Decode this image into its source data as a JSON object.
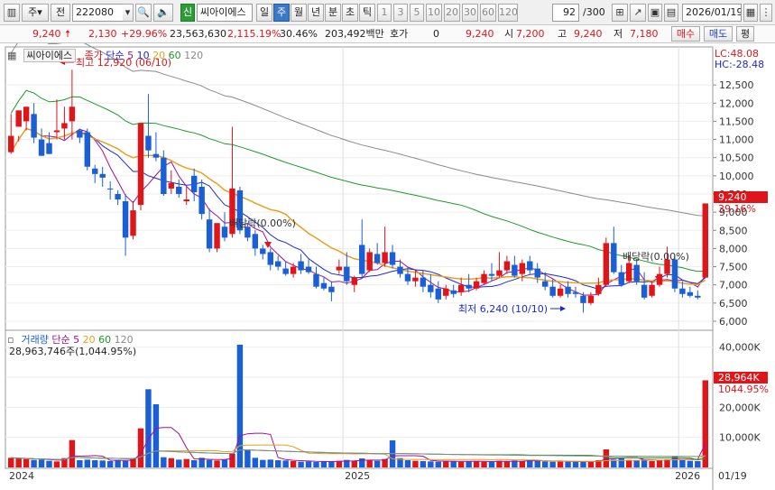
{
  "toolbar": {
    "market": "주",
    "prefix": "전",
    "code": "222080",
    "badge": "신",
    "name": "씨아이에스",
    "periods": [
      {
        "label": "일",
        "selected": false
      },
      {
        "label": "주",
        "selected": true
      },
      {
        "label": "월",
        "selected": false
      },
      {
        "label": "년",
        "selected": false
      },
      {
        "label": "분",
        "selected": false
      },
      {
        "label": "초",
        "selected": false
      },
      {
        "label": "틱",
        "selected": false
      }
    ],
    "intervals": [
      "1",
      "3",
      "5",
      "10",
      "20",
      "30",
      "60",
      "120"
    ],
    "count": "92",
    "count_total": "/300",
    "date": "2026/01/19"
  },
  "quote": {
    "price": "9,240",
    "change": "2,130",
    "change_pct": "+29.96%",
    "volume": "23,563,630",
    "volume_pct": "2,115.19%",
    "turnover_pct": "30.46%",
    "amount": "203,492백만",
    "hoga_label": "호가",
    "hoga_value": "0",
    "ask": "9,240",
    "open_label": "시",
    "open": "7,200",
    "high_label": "고",
    "high": "9,240",
    "low_label": "저",
    "low": "7,180",
    "buy_label": "매수",
    "sell_label": "매도",
    "eval_label": "평"
  },
  "price_panel": {
    "stock_tag": "씨아이에스",
    "legend_close": "종가",
    "legend_ma_type": "단순",
    "legend_mas": [
      "5",
      "10",
      "20",
      "60",
      "120"
    ],
    "lc_label": "LC:48.08",
    "hc_label": "HC:-28.48",
    "high_note": "최고 12,920 (06/10)",
    "low_note": "최저 6,240 (10/10)",
    "div_note_1": "배당락(0.00%)",
    "div_note_2": "배당락(0.00%)",
    "current_price_tag": "9,240",
    "current_pct_tag": "39.16%",
    "y_ticks": [
      "12,500",
      "12,000",
      "11,500",
      "11,000",
      "10,500",
      "10,000",
      "9,500",
      "9,000",
      "8,500",
      "8,000",
      "7,500",
      "7,000",
      "6,500",
      "6,000"
    ]
  },
  "volume_panel": {
    "legend_label": "거래량",
    "legend_ma_type": "단순",
    "legend_mas": [
      "5",
      "20",
      "60",
      "120"
    ],
    "current_text": "28,963,746주(1,044.95%)",
    "current_tag": "28,964K",
    "current_pct_tag": "1044.95%",
    "y_ticks": [
      "40,000K",
      "30,000K",
      "20,000K",
      "10,000K"
    ]
  },
  "x_axis": {
    "labels": [
      "2024",
      "2025",
      "2026"
    ],
    "cursor_date": "01/19"
  },
  "colors": {
    "up": "#e0151a",
    "down": "#1a5fd6",
    "ma5": "#a0109a",
    "ma10": "#1a2ad0",
    "ma20": "#e8a020",
    "ma60": "#1d9a2a",
    "ma120": "#8a8a8a"
  },
  "chart_data": {
    "type": "candlestick",
    "interval": "weekly",
    "y_range": [
      5950,
      12900
    ],
    "candles": [
      [
        11100,
        11700,
        10650,
        10600,
        "u"
      ],
      [
        11800,
        11100,
        11350,
        10950,
        "u"
      ],
      [
        11500,
        11900,
        11900,
        11250,
        "u"
      ],
      [
        11700,
        12000,
        11050,
        10900,
        "d"
      ],
      [
        11000,
        11300,
        10550,
        10550,
        "d"
      ],
      [
        10900,
        11200,
        10600,
        10600,
        "d"
      ],
      [
        11250,
        12100,
        11200,
        11000,
        "u"
      ],
      [
        11300,
        11900,
        11450,
        11000,
        "u"
      ],
      [
        11500,
        12920,
        11900,
        11000,
        "u"
      ],
      [
        11050,
        11300,
        11250,
        10900,
        "d"
      ],
      [
        11200,
        11300,
        10250,
        10150,
        "d"
      ],
      [
        10200,
        10300,
        10050,
        9800,
        "d"
      ],
      [
        10050,
        10250,
        9950,
        9700,
        "d"
      ],
      [
        9650,
        9850,
        9650,
        9350,
        "d"
      ],
      [
        9500,
        9600,
        9350,
        9200,
        "d"
      ],
      [
        9300,
        9500,
        8300,
        7800,
        "d"
      ],
      [
        8350,
        9300,
        9050,
        8250,
        "u"
      ],
      [
        9200,
        11100,
        11450,
        9050,
        "u"
      ],
      [
        11100,
        12250,
        10700,
        10500,
        "d"
      ],
      [
        10500,
        11200,
        10600,
        10400,
        "d"
      ],
      [
        10500,
        10700,
        9500,
        9450,
        "d"
      ],
      [
        9800,
        10150,
        9650,
        9500,
        "u"
      ],
      [
        9700,
        9900,
        9500,
        9400,
        "d"
      ],
      [
        9350,
        9700,
        9300,
        9200,
        "u"
      ],
      [
        10000,
        10200,
        9550,
        9300,
        "d"
      ],
      [
        9700,
        9900,
        8950,
        8800,
        "d"
      ],
      [
        8800,
        9100,
        8000,
        7900,
        "d"
      ],
      [
        8000,
        8200,
        8700,
        7900,
        "u"
      ],
      [
        8600,
        9000,
        8300,
        8200,
        "d"
      ],
      [
        8400,
        11350,
        9650,
        8300,
        "u"
      ],
      [
        9600,
        9700,
        8500,
        8400,
        "d"
      ],
      [
        8600,
        8700,
        8300,
        8200,
        "d"
      ],
      [
        8400,
        8500,
        8000,
        7800,
        "d"
      ],
      [
        8000,
        8100,
        7850,
        7700,
        "d"
      ],
      [
        7900,
        8000,
        7550,
        7400,
        "d"
      ],
      [
        7650,
        7800,
        7500,
        7400,
        "d"
      ],
      [
        7450,
        7650,
        7300,
        7250,
        "d"
      ],
      [
        7300,
        7600,
        7500,
        7200,
        "u"
      ],
      [
        7650,
        7850,
        7400,
        7300,
        "d"
      ],
      [
        7500,
        7700,
        7350,
        7300,
        "d"
      ],
      [
        7300,
        7500,
        6950,
        6900,
        "d"
      ],
      [
        7050,
        7200,
        6900,
        6850,
        "d"
      ],
      [
        6950,
        7100,
        6800,
        6550,
        "d"
      ],
      [
        7400,
        7700,
        7500,
        7300,
        "u"
      ],
      [
        7500,
        7900,
        7100,
        7000,
        "d"
      ],
      [
        7000,
        7250,
        7200,
        6800,
        "u"
      ],
      [
        8100,
        8800,
        7300,
        7200,
        "d"
      ],
      [
        7400,
        8000,
        7900,
        7350,
        "u"
      ],
      [
        7850,
        8150,
        7600,
        7550,
        "d"
      ],
      [
        7600,
        8600,
        7900,
        7500,
        "u"
      ],
      [
        7900,
        8100,
        7550,
        7450,
        "d"
      ],
      [
        7500,
        7700,
        7300,
        7200,
        "d"
      ],
      [
        7300,
        7500,
        7100,
        7000,
        "d"
      ],
      [
        7100,
        7400,
        7200,
        6950,
        "u"
      ],
      [
        7200,
        7400,
        6950,
        6800,
        "d"
      ],
      [
        7000,
        7300,
        6800,
        6650,
        "d"
      ],
      [
        6900,
        7100,
        6600,
        6500,
        "d"
      ],
      [
        6700,
        7000,
        6900,
        6600,
        "u"
      ],
      [
        6850,
        7000,
        6750,
        6650,
        "d"
      ],
      [
        6800,
        7200,
        7000,
        6700,
        "u"
      ],
      [
        7000,
        7300,
        6900,
        6800,
        "d"
      ],
      [
        6900,
        7200,
        7100,
        6850,
        "u"
      ],
      [
        7050,
        7400,
        7300,
        7000,
        "u"
      ],
      [
        7300,
        7600,
        7250,
        7100,
        "d"
      ],
      [
        7250,
        7900,
        7400,
        7200,
        "u"
      ],
      [
        7400,
        7800,
        7650,
        7300,
        "u"
      ],
      [
        7550,
        7800,
        7250,
        7200,
        "d"
      ],
      [
        7300,
        7700,
        7600,
        7100,
        "u"
      ],
      [
        7650,
        7800,
        7400,
        7300,
        "d"
      ],
      [
        7450,
        7600,
        7200,
        7050,
        "d"
      ],
      [
        7100,
        7350,
        6950,
        6850,
        "d"
      ],
      [
        6950,
        7150,
        6700,
        6650,
        "d"
      ],
      [
        6700,
        7000,
        6900,
        6650,
        "u"
      ],
      [
        6950,
        7100,
        6750,
        6650,
        "d"
      ],
      [
        6800,
        6950,
        6750,
        6650,
        "d"
      ],
      [
        6700,
        6800,
        6500,
        6240,
        "d"
      ],
      [
        6500,
        6800,
        6700,
        6450,
        "u"
      ],
      [
        6750,
        7200,
        7000,
        6700,
        "u"
      ],
      [
        7000,
        8300,
        8150,
        6950,
        "u"
      ],
      [
        8150,
        8600,
        7350,
        7300,
        "d"
      ],
      [
        7350,
        7550,
        7000,
        6950,
        "d"
      ],
      [
        7100,
        7800,
        7600,
        7050,
        "u"
      ],
      [
        7550,
        7700,
        7100,
        7000,
        "d"
      ],
      [
        7000,
        7350,
        6650,
        6600,
        "d"
      ],
      [
        6700,
        7100,
        7000,
        6650,
        "u"
      ],
      [
        7000,
        7500,
        7300,
        6950,
        "u"
      ],
      [
        7300,
        8050,
        7700,
        7200,
        "u"
      ],
      [
        7700,
        7800,
        6900,
        6800,
        "d"
      ],
      [
        6900,
        7100,
        6750,
        6650,
        "d"
      ],
      [
        6800,
        6950,
        6700,
        6650,
        "d"
      ],
      [
        6700,
        6850,
        6650,
        6600,
        "d"
      ],
      [
        7200,
        9240,
        9240,
        7180,
        "u"
      ]
    ],
    "volume": [
      3200,
      3000,
      2800,
      2500,
      2600,
      2200,
      2000,
      3100,
      9100,
      2400,
      2600,
      2400,
      2300,
      2100,
      2500,
      2200,
      3000,
      13000,
      26000,
      21000,
      3400,
      3100,
      2600,
      2800,
      2400,
      3200,
      2500,
      2300,
      2600,
      4500,
      40800,
      5800,
      3200,
      2500,
      2600,
      2400,
      2300,
      2100,
      1900,
      2000,
      1800,
      2100,
      2000,
      2200,
      2500,
      2100,
      3000,
      2400,
      2200,
      2800,
      9000,
      3100,
      2400,
      2200,
      2100,
      2000,
      1900,
      2200,
      2100,
      1900,
      2000,
      2100,
      1900,
      1800,
      2200,
      2000,
      2300,
      2100,
      2500,
      2200,
      2000,
      1900,
      2100,
      2000,
      1900,
      1800,
      1900,
      2400,
      6000,
      2600,
      3000,
      2500,
      2400,
      2700,
      2100,
      2300,
      2700,
      3800,
      2500,
      2200,
      2100,
      28964
    ]
  }
}
